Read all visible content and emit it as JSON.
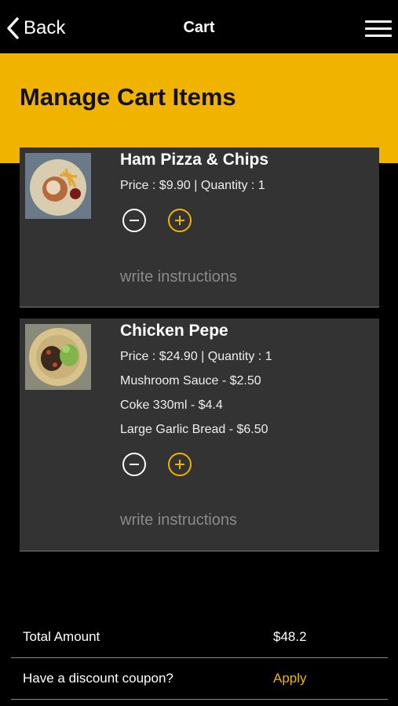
{
  "nav": {
    "back_label": "Back",
    "title": "Cart"
  },
  "banner": {
    "title": "Manage Cart Items"
  },
  "cart_items": [
    {
      "name": "Ham Pizza & Chips",
      "price_line": "Price : $9.90 | Quantity : 1",
      "extras": [],
      "instructions_placeholder": "write instructions",
      "image_icon": "food-photo"
    },
    {
      "name": "Chicken Pepe",
      "price_line": "Price : $24.90 | Quantity : 1",
      "extras": [
        "Mushroom Sauce - $2.50",
        "Coke 330ml - $4.4",
        "Large Garlic Bread - $6.50"
      ],
      "instructions_placeholder": "write instructions",
      "image_icon": "food-photo"
    }
  ],
  "summary": {
    "total_label": "Total Amount",
    "total_value": "$48.2",
    "coupon_label": "Have a discount coupon?",
    "apply_label": "Apply"
  },
  "colors": {
    "accent": "#f0b400",
    "card_bg": "#333333",
    "page_bg": "#000000"
  }
}
